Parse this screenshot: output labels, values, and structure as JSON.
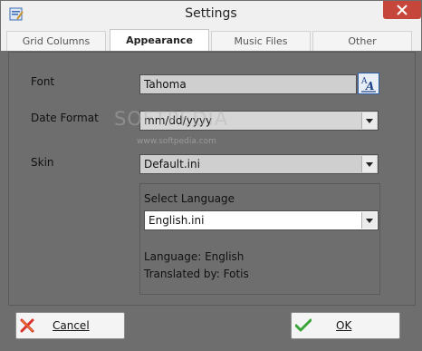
{
  "window": {
    "title": "Settings"
  },
  "tabs": [
    {
      "label": "Grid Columns"
    },
    {
      "label": "Appearance"
    },
    {
      "label": "Music Files"
    },
    {
      "label": "Other"
    }
  ],
  "appearance": {
    "font_label": "Font",
    "font_value": "Tahoma",
    "date_format_label": "Date Format",
    "date_format_value": "mm/dd/yyyy",
    "skin_label": "Skin",
    "skin_value": "Default.ini",
    "select_language_label": "Select Language",
    "language_value": "English.ini",
    "language_info": "Language: English",
    "translated_by": "Translated by: Fotis"
  },
  "buttons": {
    "cancel_label": "Cancel",
    "ok_label": "OK"
  },
  "watermark": {
    "text": "SOFTPEDIA",
    "url": "www.softpedia.com"
  },
  "colors": {
    "close_red": "#c7463c",
    "panel_gray": "#6e6e6e",
    "active_tab": "#ffffff"
  },
  "icons": [
    "app-settings-icon",
    "close-icon",
    "font-picker-icon",
    "cancel-x-icon",
    "ok-check-icon"
  ]
}
